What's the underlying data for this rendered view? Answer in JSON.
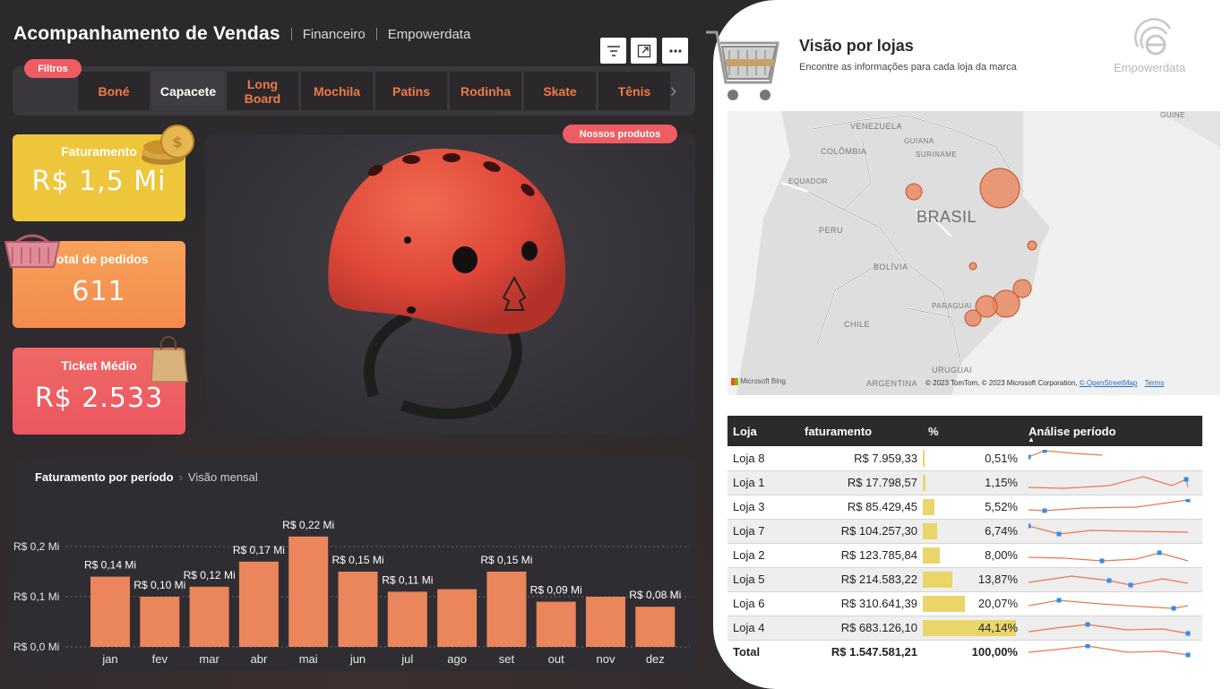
{
  "header": {
    "title": "Acompanhamento de Vendas",
    "crumb1": "Financeiro",
    "crumb2": "Empowerdata"
  },
  "filters": {
    "label": "Filtros",
    "tabs": [
      "Boné",
      "Capacete",
      "Long Board",
      "Mochila",
      "Patins",
      "Rodinha",
      "Skate",
      "Tênis"
    ],
    "active": "Capacete"
  },
  "kpis": {
    "faturamento": {
      "label": "Faturamento",
      "value": "R$ 1,5 Mi"
    },
    "pedidos": {
      "label": "Total de pedidos",
      "value": "611"
    },
    "ticket": {
      "label": "Ticket Médio",
      "value": "R$ 2.533"
    }
  },
  "product": {
    "badge": "Nossos produtos"
  },
  "chart": {
    "title": "Faturamento por período",
    "subtitle": "Visão mensal"
  },
  "chart_data": {
    "type": "bar",
    "title": "Faturamento por período",
    "categories": [
      "jan",
      "fev",
      "mar",
      "abr",
      "mai",
      "jun",
      "jul",
      "ago",
      "set",
      "out",
      "nov",
      "dez"
    ],
    "values": [
      0.14,
      0.1,
      0.12,
      0.17,
      0.22,
      0.15,
      0.11,
      0.115,
      0.15,
      0.09,
      0.1,
      0.08
    ],
    "data_labels": [
      "R$ 0,14 Mi",
      "R$ 0,10 Mi",
      "R$ 0,12 Mi",
      "R$ 0,17 Mi",
      "R$ 0,22 Mi",
      "R$ 0,15 Mi",
      "R$ 0,11 Mi",
      "",
      "R$ 0,15 Mi",
      "R$ 0,09 Mi",
      "",
      "R$ 0,08 Mi"
    ],
    "yticks": [
      "R$ 0,0 Mi",
      "R$ 0,1 Mi",
      "R$ 0,2 Mi"
    ],
    "ylim": [
      0,
      0.2
    ],
    "color": "#ea855c",
    "grid": true
  },
  "right": {
    "title": "Visão por lojas",
    "subtitle": "Encontre as informações para cada loja da marca",
    "brand": "Empowerdata"
  },
  "map": {
    "labels": [
      "VENEZUELA",
      "COLÔMBIA",
      "GUIANA",
      "SURINAME",
      "GUINE",
      "EQUADOR",
      "BRASIL",
      "PERU",
      "BOLÍVIA",
      "PARAGUAI",
      "CHILE",
      "URUGUAI",
      "ARGENTINA"
    ],
    "bing": "Microsoft Bing",
    "copyright": "© 2023 TomTom, © 2023 Microsoft Corporation,",
    "osm": "© OpenStreetMap",
    "terms": "Terms"
  },
  "table": {
    "headers": [
      "Loja",
      "faturamento",
      "%",
      "Análise período"
    ],
    "rows": [
      {
        "loja": "Loja 8",
        "fat": "R$ 7.959,33",
        "pct": "0,51%",
        "p": 0.51
      },
      {
        "loja": "Loja 1",
        "fat": "R$ 17.798,57",
        "pct": "1,15%",
        "p": 1.15
      },
      {
        "loja": "Loja 3",
        "fat": "R$ 85.429,45",
        "pct": "5,52%",
        "p": 5.52
      },
      {
        "loja": "Loja 7",
        "fat": "R$ 104.257,30",
        "pct": "6,74%",
        "p": 6.74
      },
      {
        "loja": "Loja 2",
        "fat": "R$ 123.785,84",
        "pct": "8,00%",
        "p": 8.0
      },
      {
        "loja": "Loja 5",
        "fat": "R$ 214.583,22",
        "pct": "13,87%",
        "p": 13.87
      },
      {
        "loja": "Loja 6",
        "fat": "R$ 310.641,39",
        "pct": "20,07%",
        "p": 20.07
      },
      {
        "loja": "Loja 4",
        "fat": "R$ 683.126,10",
        "pct": "44,14%",
        "p": 44.14
      }
    ],
    "total": {
      "loja": "Total",
      "fat": "R$ 1.547.581,21",
      "pct": "100,00%"
    }
  },
  "colors": {
    "accent": "#ef5d64",
    "orange": "#ea855c",
    "yellow": "#eec63c",
    "spark": "#e8794f",
    "marker": "#2f8fe6"
  }
}
